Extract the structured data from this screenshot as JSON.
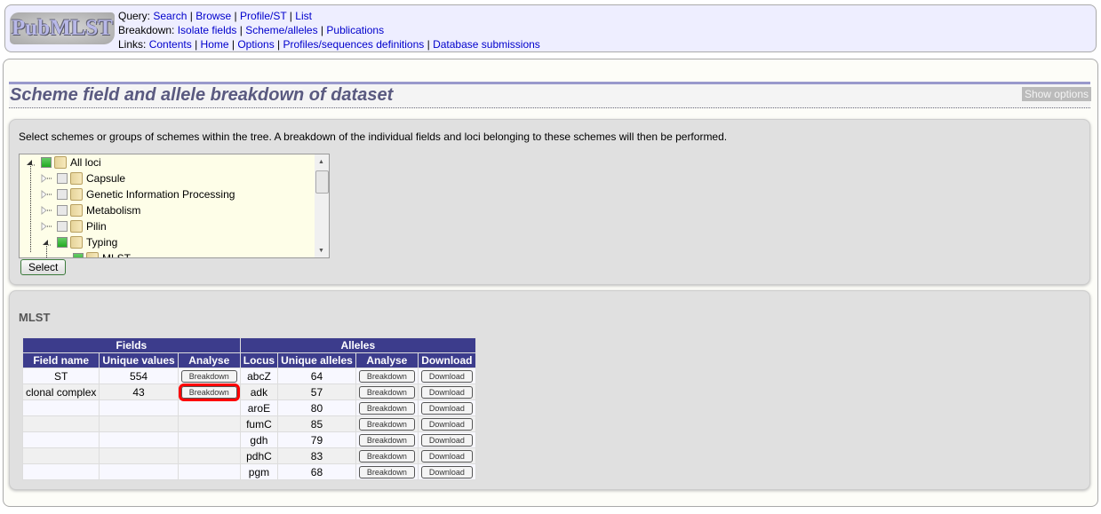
{
  "header": {
    "logo": "PubMLST",
    "query_label": "Query:",
    "query": [
      "Search",
      "Browse",
      "Profile/ST",
      "List"
    ],
    "breakdown_label": "Breakdown:",
    "breakdown": [
      "Isolate fields",
      "Scheme/alleles",
      "Publications"
    ],
    "links_label": "Links:",
    "links": [
      "Contents",
      "Home",
      "Options",
      "Profiles/sequences definitions",
      "Database submissions"
    ]
  },
  "page_title": "Scheme field and allele breakdown of dataset",
  "show_options": "Show options",
  "instructions": "Select schemes or groups of schemes within the tree. A breakdown of the individual fields and loci belonging to these schemes will then be performed.",
  "tree": [
    {
      "label": "All loci",
      "level": 0,
      "expanded": true,
      "checked": true
    },
    {
      "label": "Capsule",
      "level": 1,
      "expanded": false,
      "checked": false
    },
    {
      "label": "Genetic Information Processing",
      "level": 1,
      "expanded": false,
      "checked": false
    },
    {
      "label": "Metabolism",
      "level": 1,
      "expanded": false,
      "checked": false
    },
    {
      "label": "Pilin",
      "level": 1,
      "expanded": false,
      "checked": false
    },
    {
      "label": "Typing",
      "level": 1,
      "expanded": true,
      "checked": true
    },
    {
      "label": "MLST",
      "level": 2,
      "expanded": false,
      "checked": true
    }
  ],
  "select_button": "Select",
  "scheme": {
    "name": "MLST",
    "group_headers": [
      "Fields",
      "Alleles"
    ],
    "columns": [
      "Field name",
      "Unique values",
      "Analyse",
      "Locus",
      "Unique alleles",
      "Analyse",
      "Download"
    ],
    "fields": [
      {
        "name": "ST",
        "unique": "554",
        "button": "Breakdown",
        "highlighted": false
      },
      {
        "name": "clonal complex",
        "unique": "43",
        "button": "Breakdown",
        "highlighted": true
      }
    ],
    "alleles": [
      {
        "locus": "abcZ",
        "unique": "64"
      },
      {
        "locus": "adk",
        "unique": "57"
      },
      {
        "locus": "aroE",
        "unique": "80"
      },
      {
        "locus": "fumC",
        "unique": "85"
      },
      {
        "locus": "gdh",
        "unique": "79"
      },
      {
        "locus": "pdhC",
        "unique": "83"
      },
      {
        "locus": "pgm",
        "unique": "68"
      }
    ],
    "breakdown_label": "Breakdown",
    "download_label": "Download"
  },
  "colors": {
    "table_header": "#3c3c8c",
    "highlight": "#ff0000",
    "title": "#5a5a80"
  }
}
